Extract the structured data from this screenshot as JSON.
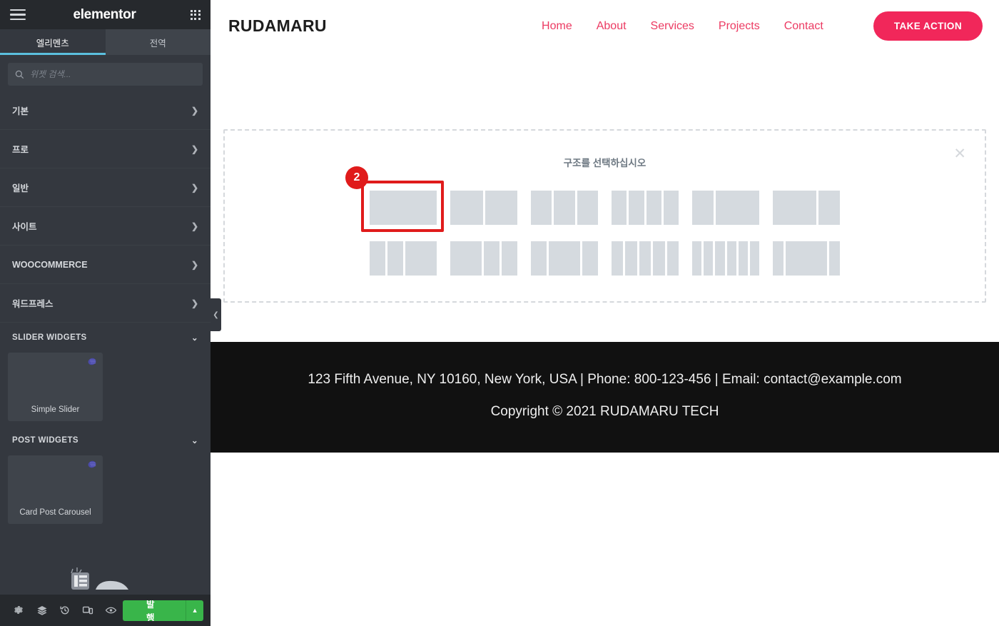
{
  "panel": {
    "brand": "elementor",
    "menu_icon": "hamburger-icon",
    "apps_icon": "grid-apps-icon",
    "tabs": [
      {
        "label": "엘리멘츠",
        "active": true
      },
      {
        "label": "전역",
        "active": false
      }
    ],
    "search": {
      "placeholder": "위젯 검색...",
      "value": "",
      "icon": "search-icon"
    },
    "categories": [
      {
        "label": "기본",
        "chevron": "chevron-right-icon"
      },
      {
        "label": "프로",
        "chevron": "chevron-right-icon"
      },
      {
        "label": "일반",
        "chevron": "chevron-right-icon"
      },
      {
        "label": "사이트",
        "chevron": "chevron-right-icon"
      },
      {
        "label": "WOOCOMMERCE",
        "chevron": "chevron-right-icon"
      },
      {
        "label": "워드프레스",
        "chevron": "chevron-right-icon"
      }
    ],
    "sections": [
      {
        "title": "SLIDER WIDGETS",
        "chevron": "chevron-down-icon",
        "widgets": [
          {
            "label": "Simple Slider",
            "badge": "pro-badge-icon"
          }
        ]
      },
      {
        "title": "POST WIDGETS",
        "chevron": "chevron-down-icon",
        "widgets": [
          {
            "label": "Card Post Carousel",
            "badge": "pro-badge-icon"
          }
        ]
      }
    ],
    "footer": {
      "buttons": [
        {
          "name": "settings-icon"
        },
        {
          "name": "navigator-layers-icon"
        },
        {
          "name": "history-icon"
        },
        {
          "name": "responsive-mode-icon"
        },
        {
          "name": "preview-eye-icon"
        }
      ],
      "publish_label": "발행",
      "publish_arrow": "caret-up-icon",
      "publish_color": "#39b54a"
    },
    "collapse_handle": "chevron-left-icon"
  },
  "site": {
    "logo": "RUDAMARU",
    "nav": [
      {
        "label": "Home"
      },
      {
        "label": "About"
      },
      {
        "label": "Services"
      },
      {
        "label": "Projects"
      },
      {
        "label": "Contact"
      }
    ],
    "cta_label": "TAKE ACTION",
    "accent_color": "#f1275a",
    "footer": {
      "contact": "123 Fifth Avenue, NY 10160, New York, USA | Phone: 800-123-456 | Email: contact@example.com",
      "copyright": "Copyright © 2021 RUDAMARU TECH"
    }
  },
  "add_section": {
    "title": "구조를 선택하십시오",
    "close_icon": "close-x-icon",
    "annotation": {
      "number": "2",
      "color": "#e01b1b"
    },
    "presets": [
      {
        "columns": [
          100
        ],
        "selected": true
      },
      {
        "columns": [
          50,
          50
        ],
        "selected": false
      },
      {
        "columns": [
          33,
          33,
          33
        ],
        "selected": false
      },
      {
        "columns": [
          25,
          25,
          25,
          25
        ],
        "selected": false
      },
      {
        "columns": [
          33,
          67
        ],
        "selected": false
      },
      {
        "columns": [
          67,
          33
        ],
        "selected": false
      },
      {
        "columns": [
          25,
          25,
          50
        ],
        "selected": false
      },
      {
        "columns": [
          50,
          25,
          25
        ],
        "selected": false
      },
      {
        "columns": [
          25,
          50,
          25
        ],
        "selected": false
      },
      {
        "columns": [
          20,
          20,
          20,
          20,
          20
        ],
        "selected": false
      },
      {
        "columns": [
          16,
          16,
          16,
          16,
          16,
          16
        ],
        "selected": false
      },
      {
        "columns": [
          17,
          66,
          17
        ],
        "selected": false
      }
    ]
  }
}
